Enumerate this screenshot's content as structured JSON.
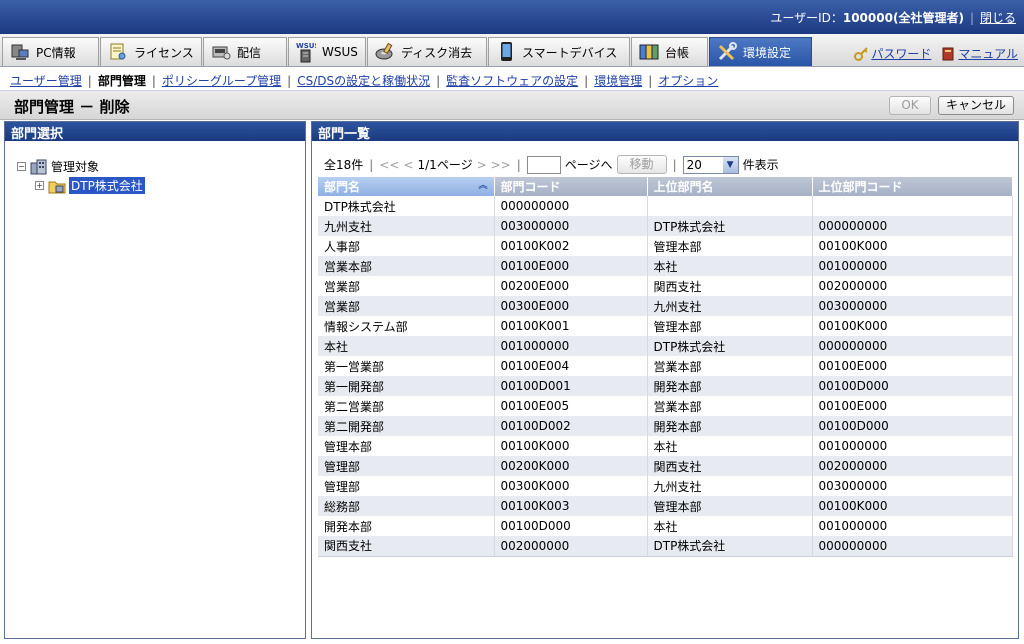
{
  "topbar": {
    "user_label": "ユーザーID：",
    "user_value": "100000(全社管理者)",
    "logout": "閉じる"
  },
  "tabs": [
    {
      "label": "PC情報",
      "icon": "pc-icon"
    },
    {
      "label": "ライセンス",
      "icon": "license-icon"
    },
    {
      "label": "配信",
      "icon": "distribution-icon"
    },
    {
      "label": "WSUS",
      "icon": "wsus-icon"
    },
    {
      "label": "ディスク消去",
      "icon": "disk-erase-icon"
    },
    {
      "label": "スマートデバイス",
      "icon": "smart-device-icon"
    },
    {
      "label": "台帳",
      "icon": "ledger-icon"
    },
    {
      "label": "環境設定",
      "icon": "settings-tools-icon"
    }
  ],
  "links": {
    "password": "パスワード",
    "manual": "マニュアル"
  },
  "subnav": [
    {
      "label": "ユーザー管理",
      "current": false
    },
    {
      "label": "部門管理",
      "current": true
    },
    {
      "label": "ポリシーグループ管理",
      "current": false
    },
    {
      "label": "CS/DSの設定と稼働状況",
      "current": false
    },
    {
      "label": "監査ソフトウェアの設定",
      "current": false
    },
    {
      "label": "環境管理",
      "current": false
    },
    {
      "label": "オプション",
      "current": false
    }
  ],
  "page": {
    "title": "部門管理 － 削除",
    "ok": "OK",
    "cancel": "キャンセル"
  },
  "left_panel": {
    "header": "部門選択",
    "root": "管理対象",
    "child": "DTP株式会社"
  },
  "right_panel": {
    "header": "部門一覧"
  },
  "pager": {
    "total": "全18件",
    "first": "<<",
    "prev": "<",
    "page_info": "1/1ページ",
    "next": ">",
    "last": ">>",
    "page_input": "",
    "goto_label": "ページへ",
    "move": "移動",
    "per_page": "20",
    "per_page_label": "件表示"
  },
  "table": {
    "columns": [
      "部門名",
      "部門コード",
      "上位部門名",
      "上位部門コード"
    ],
    "rows": [
      [
        "DTP株式会社",
        "000000000",
        "",
        ""
      ],
      [
        "九州支社",
        "003000000",
        "DTP株式会社",
        "000000000"
      ],
      [
        "人事部",
        "00100K002",
        "管理本部",
        "00100K000"
      ],
      [
        "営業本部",
        "00100E000",
        "本社",
        "001000000"
      ],
      [
        "営業部",
        "00200E000",
        "関西支社",
        "002000000"
      ],
      [
        "営業部",
        "00300E000",
        "九州支社",
        "003000000"
      ],
      [
        "情報システム部",
        "00100K001",
        "管理本部",
        "00100K000"
      ],
      [
        "本社",
        "001000000",
        "DTP株式会社",
        "000000000"
      ],
      [
        "第一営業部",
        "00100E004",
        "営業本部",
        "00100E000"
      ],
      [
        "第一開発部",
        "00100D001",
        "開発本部",
        "00100D000"
      ],
      [
        "第二営業部",
        "00100E005",
        "営業本部",
        "00100E000"
      ],
      [
        "第二開発部",
        "00100D002",
        "開発本部",
        "00100D000"
      ],
      [
        "管理本部",
        "00100K000",
        "本社",
        "001000000"
      ],
      [
        "管理部",
        "00200K000",
        "関西支社",
        "002000000"
      ],
      [
        "管理部",
        "00300K000",
        "九州支社",
        "003000000"
      ],
      [
        "総務部",
        "00100K003",
        "管理本部",
        "00100K000"
      ],
      [
        "開発本部",
        "00100D000",
        "本社",
        "001000000"
      ],
      [
        "関西支社",
        "002000000",
        "DTP株式会社",
        "000000000"
      ]
    ]
  }
}
